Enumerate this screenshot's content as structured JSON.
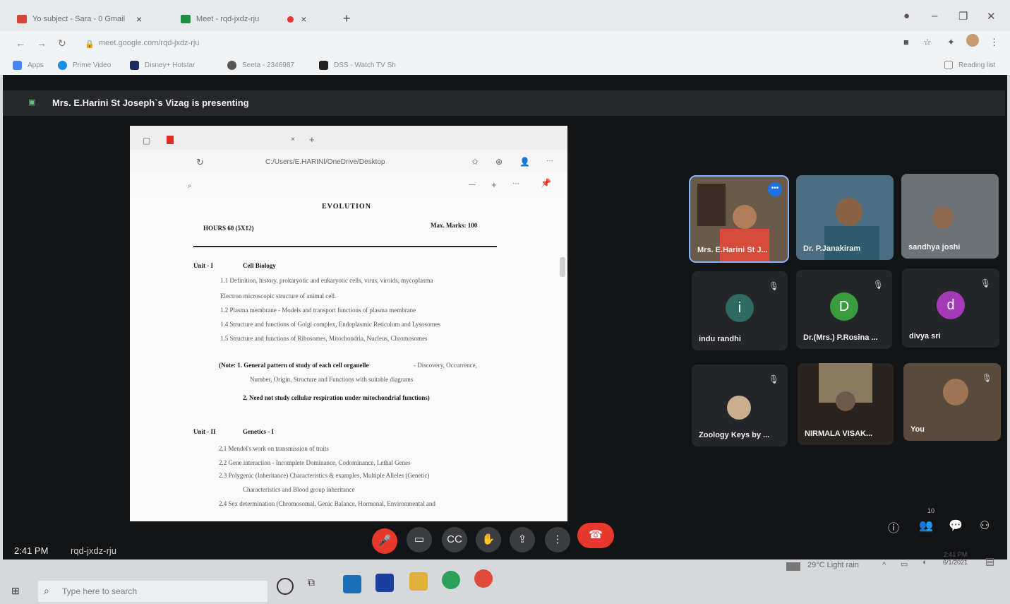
{
  "browser": {
    "tabs": [
      {
        "label": "Yo subject - Sara - 0 Gmail"
      },
      {
        "label": "Meet - rqd-jxdz-rju"
      }
    ],
    "url": "meet.google.com/rqd-jxdz-rju",
    "bookmarks": [
      "Apps",
      "Prime Video",
      "Disney+ Hotstar",
      "Seeta - 2346987",
      "DSS - Watch TV Sh"
    ],
    "reading_list": "Reading list"
  },
  "meet": {
    "presenting_text": "Mrs. E.Harini St Joseph`s Vizag is presenting",
    "time": "2:41 PM",
    "meeting_code": "rqd-jxdz-rju",
    "participants_count": "10",
    "participants": [
      {
        "name": "Mrs. E.Harini St J..."
      },
      {
        "name": "Dr. P.Janakiram"
      },
      {
        "name": "sandhya joshi"
      },
      {
        "name": "indu randhi",
        "initial": "i"
      },
      {
        "name": "Dr.(Mrs.) P.Rosina ...",
        "initial": "D"
      },
      {
        "name": "divya sri",
        "initial": "d"
      },
      {
        "name": "Zoology Keys by ..."
      },
      {
        "name": "NIRMALA VISAK..."
      },
      {
        "name": "You"
      }
    ]
  },
  "document": {
    "path": "C:/Users/E.HARINI/OneDrive/Desktop",
    "title": "EVOLUTION",
    "hours": "HOURS 60   (5X12)",
    "max_marks": "Max. Marks: 100",
    "unit1_label": "Unit - I",
    "unit1_title": "Cell Biology",
    "unit1_lines": [
      "1.1 Definition, history, prokaryotic and eukaryotic cells, virus, viroids, mycoplasma",
      "Electron microscopic structure of animal cell.",
      "1.2 Plasma membrane - Models and transport functions of plasma membrane",
      "1.4 Structure and functions of Golgi complex, Endoplasmic Reticulum and Lysosomes",
      "1.5 Structure and functions of Ribosomes, Mitochondria, Nucleus, Chromosomes"
    ],
    "note_label": "(Note: 1. General pattern of study of each cell organelle",
    "note_rest": "- Discovery, Occurrence,",
    "note_line2": "Number, Origin, Structure and Functions with suitable diagrams",
    "note_2": "2. Need not study cellular respiration under mitochondrial functions)",
    "unit2_label": "Unit - II",
    "unit2_title": "Genetics - I",
    "unit2_lines": [
      "2.1 Mendel's work on transmission of traits",
      "2.2 Gene interaction - Incomplete Dominance, Codominance, Lethal Genes",
      "2.3 Polygenic (Inheritance) Characteristics & examples, Multiple Alleles (Genetic)",
      "Characteristics and Blood group inheritance",
      "2.4 Sex determination (Chromosomal, Genic Balance, Hormonal, Environmental and"
    ]
  },
  "taskbar": {
    "search_placeholder": "Type here to search",
    "weather": "29°C  Light rain",
    "clock_time": "2:41 PM",
    "clock_date": "6/1/2021"
  }
}
